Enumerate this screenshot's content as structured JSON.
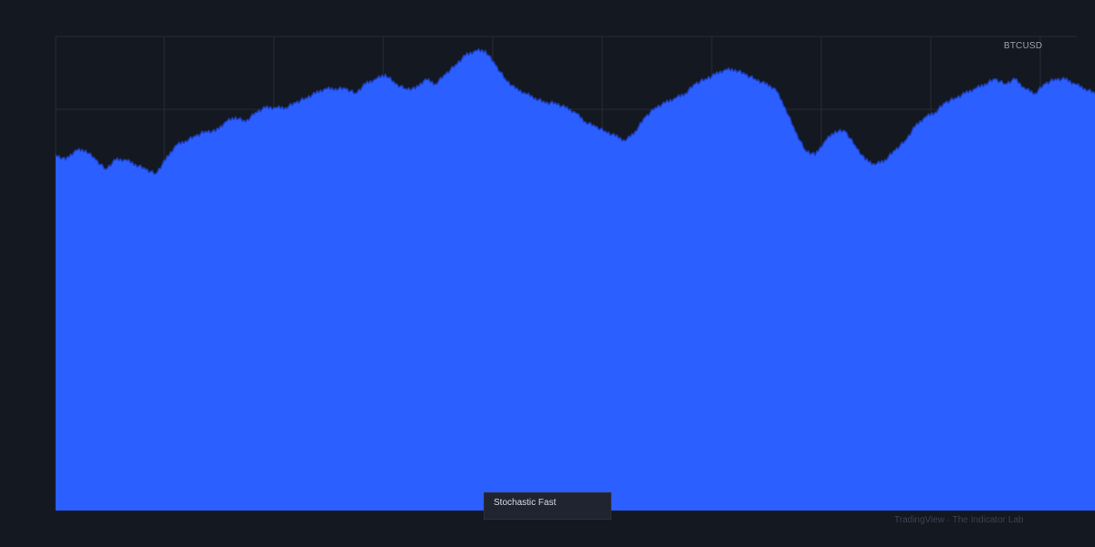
{
  "chart": {
    "symbol": "BTCUSD",
    "tooltip_label": "Stochastic Fast",
    "watermark": "TradingView · The Indicator Lab"
  },
  "colors": {
    "background": "#141821",
    "grid": "#262b36",
    "fill": "#2b5fff",
    "outline": "#1d3db8"
  },
  "chart_data": {
    "type": "area",
    "title": "",
    "xlabel": "",
    "ylabel": "",
    "grid": true,
    "x_tick_labels": [],
    "y_tick_labels": [],
    "ylim": [
      0,
      100
    ],
    "series": [
      {
        "values": [
          75,
          74,
          76,
          76,
          74,
          72,
          74,
          74,
          73,
          72,
          71,
          74,
          77,
          78,
          79,
          80,
          80,
          82,
          83,
          82,
          84,
          85,
          85,
          85,
          86,
          87,
          88,
          89,
          89,
          89,
          88,
          90,
          91,
          92,
          90,
          89,
          89,
          91,
          90,
          92,
          94,
          96,
          97,
          97,
          94,
          91,
          89,
          88,
          87,
          86,
          86,
          85,
          84,
          82,
          81,
          80,
          79,
          78,
          80,
          83,
          85,
          86,
          87,
          88,
          90,
          91,
          92,
          93,
          93,
          92,
          91,
          90,
          89,
          85,
          80,
          76,
          75,
          78,
          80,
          80,
          77,
          74,
          73,
          74,
          76,
          78,
          81,
          83,
          84,
          86,
          87,
          88,
          89,
          90,
          91,
          90,
          91,
          89,
          88,
          90,
          91,
          91,
          90,
          89,
          88
        ]
      }
    ]
  }
}
